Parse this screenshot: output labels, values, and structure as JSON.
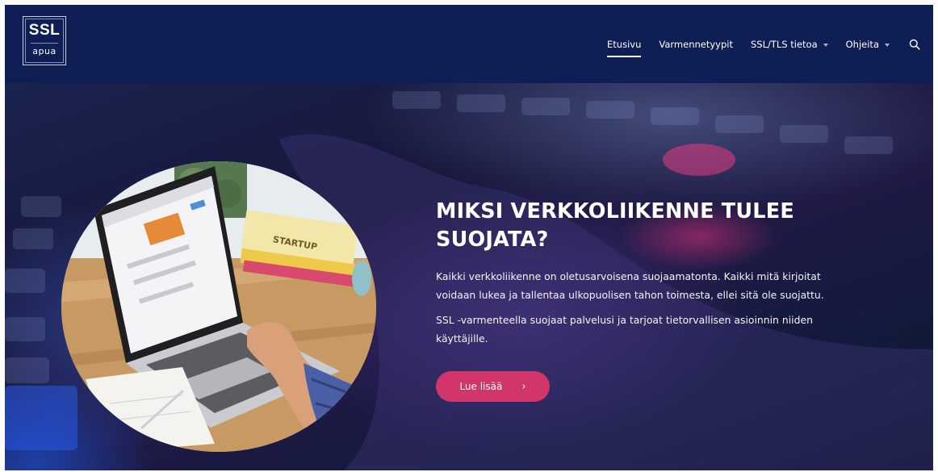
{
  "logo": {
    "top": "SSL",
    "bottom": "apua"
  },
  "nav": {
    "items": [
      {
        "label": "Etusivu",
        "active": true,
        "dropdown": false
      },
      {
        "label": "Varmennetyypit",
        "active": false,
        "dropdown": false
      },
      {
        "label": "SSL/TLS tietoa",
        "active": false,
        "dropdown": true
      },
      {
        "label": "Ohjeita",
        "active": false,
        "dropdown": true
      }
    ],
    "search_icon": "search-icon"
  },
  "hero": {
    "title_line1": "MIKSI VERKKOLIIKENNE TULEE",
    "title_line2": "SUOJATA?",
    "paragraph1_line1": "Kaikki verkkoliikenne on oletusarvoisena suojaamatonta. Kaikki mitä kirjoitat",
    "paragraph1_line2": "voidaan lukea ja tallentaa ulkopuolisen tahon toimesta, ellei sitä ole suojattu.",
    "paragraph2_line1": "SSL -varmenteella suojaat palvelusi ja tarjoat tietorvallisen asioinnin niiden",
    "paragraph2_line2": "käyttäjille.",
    "cta_label": "Lue lisää",
    "cta_arrow": "›",
    "image_label": "STARTUP"
  },
  "colors": {
    "header_bg": "#0f1e55",
    "accent": "#d1356a",
    "text": "#ffffff"
  }
}
